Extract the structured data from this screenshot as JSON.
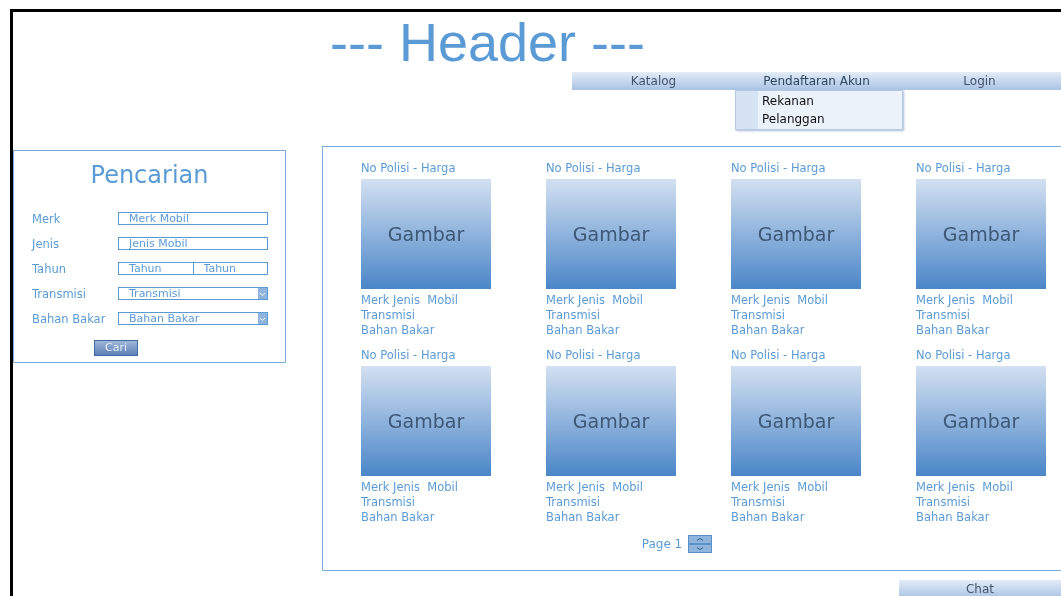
{
  "header": {
    "title": "--- Header ---"
  },
  "nav": {
    "items": [
      {
        "label": "Katalog",
        "expanded": false
      },
      {
        "label": "Pendaftaran Akun",
        "expanded": true,
        "submenu": [
          "Rekanan",
          "Pelanggan"
        ]
      },
      {
        "label": "Login",
        "expanded": false
      }
    ]
  },
  "search": {
    "title": "Pencarian",
    "fields": [
      {
        "label": "Merk",
        "kind": "text",
        "placeholders": [
          "Merk Mobil"
        ]
      },
      {
        "label": "Jenis",
        "kind": "text",
        "placeholders": [
          "Jenis Mobil"
        ]
      },
      {
        "label": "Tahun",
        "kind": "range",
        "placeholders": [
          "Tahun",
          "Tahun"
        ]
      },
      {
        "label": "Transmisi",
        "kind": "select",
        "placeholders": [
          "Transmisi"
        ]
      },
      {
        "label": "Bahan Bakar",
        "kind": "select",
        "placeholders": [
          "Bahan Bakar"
        ]
      }
    ],
    "button": "Cari"
  },
  "catalog": {
    "cards": [
      {
        "title": "No Polisi - Harga",
        "image": "Gambar",
        "lines": [
          "Merk Jenis  Mobil",
          "Transmisi",
          "Bahan Bakar"
        ]
      },
      {
        "title": "No Polisi - Harga",
        "image": "Gambar",
        "lines": [
          "Merk Jenis  Mobil",
          "Transmisi",
          "Bahan Bakar"
        ]
      },
      {
        "title": "No Polisi - Harga",
        "image": "Gambar",
        "lines": [
          "Merk Jenis  Mobil",
          "Transmisi",
          "Bahan Bakar"
        ]
      },
      {
        "title": "No Polisi - Harga",
        "image": "Gambar",
        "lines": [
          "Merk Jenis  Mobil",
          "Transmisi",
          "Bahan Bakar"
        ]
      },
      {
        "title": "No Polisi - Harga",
        "image": "Gambar",
        "lines": [
          "Merk Jenis  Mobil",
          "Transmisi",
          "Bahan Bakar"
        ]
      },
      {
        "title": "No Polisi - Harga",
        "image": "Gambar",
        "lines": [
          "Merk Jenis  Mobil",
          "Transmisi",
          "Bahan Bakar"
        ]
      },
      {
        "title": "No Polisi - Harga",
        "image": "Gambar",
        "lines": [
          "Merk Jenis  Mobil",
          "Transmisi",
          "Bahan Bakar"
        ]
      },
      {
        "title": "No Polisi - Harga",
        "image": "Gambar",
        "lines": [
          "Merk Jenis  Mobil",
          "Transmisi",
          "Bahan Bakar"
        ]
      }
    ],
    "pager": "Page 1"
  },
  "chat": "Chat"
}
